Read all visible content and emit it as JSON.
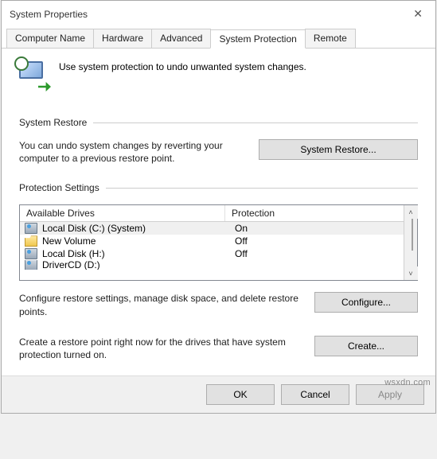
{
  "window": {
    "title": "System Properties"
  },
  "tabs": [
    {
      "label": "Computer Name"
    },
    {
      "label": "Hardware"
    },
    {
      "label": "Advanced"
    },
    {
      "label": "System Protection"
    },
    {
      "label": "Remote"
    }
  ],
  "intro": {
    "text": "Use system protection to undo unwanted system changes."
  },
  "restore": {
    "heading": "System Restore",
    "text": "You can undo system changes by reverting your computer to a previous restore point.",
    "button": "System Restore..."
  },
  "protection": {
    "heading": "Protection Settings",
    "col_drive": "Available Drives",
    "col_prot": "Protection",
    "drives": [
      {
        "name": "Local Disk (C:) (System)",
        "prot": "On",
        "type": "disk",
        "selected": true
      },
      {
        "name": "New Volume",
        "prot": "Off",
        "type": "folder",
        "selected": false
      },
      {
        "name": "Local Disk (H:)",
        "prot": "Off",
        "type": "disk",
        "selected": false
      },
      {
        "name": "DriverCD (D:)",
        "prot": "",
        "type": "disk",
        "selected": false
      }
    ],
    "configure_text": "Configure restore settings, manage disk space, and delete restore points.",
    "configure_button": "Configure...",
    "create_text": "Create a restore point right now for the drives that have system protection turned on.",
    "create_button": "Create..."
  },
  "footer": {
    "ok": "OK",
    "cancel": "Cancel",
    "apply": "Apply"
  },
  "watermark": "wsxdn.com"
}
